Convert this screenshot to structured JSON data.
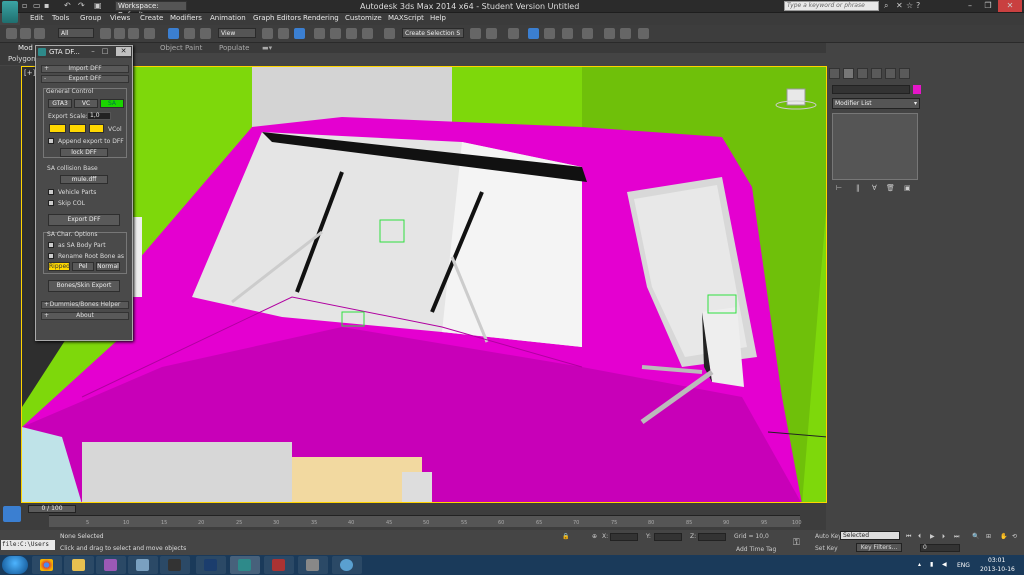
{
  "window": {
    "title": "Autodesk 3ds Max  2014 x64  - Student Version   Untitled",
    "workspace": "Workspace: Default",
    "search_placeholder": "Type a keyword or phrase"
  },
  "menu": [
    "Edit",
    "Tools",
    "Group",
    "Views",
    "Create",
    "Modifiers",
    "Animation",
    "Graph Editors",
    "Rendering",
    "Customize",
    "MAXScript",
    "Help"
  ],
  "toolbar": {
    "selection_filter": "All",
    "ref_coord": "View",
    "named_selection": "Create Selection S"
  },
  "ribbon": {
    "tabs": [
      "Mod",
      "Object Paint",
      "Populate"
    ],
    "sub": "Polygon"
  },
  "viewport": {
    "label": "[+]",
    "view_cube": "viewcube"
  },
  "gta_panel": {
    "title": "GTA DF...",
    "import": "Import DFF",
    "export": "Export DFF",
    "general_control": "General Control",
    "game_buttons": [
      "GTA3",
      "VC",
      "SA"
    ],
    "export_scale_label": "Export Scale:",
    "export_scale_value": "1,0",
    "vcol_label": "VCol",
    "append_label": "Append export to DFF",
    "lock_dff": "lock DFF",
    "sa_collision": "SA collision Base",
    "mule_dff": "mule.dff",
    "vehicle_parts": "Vehicle Parts",
    "skip_col": "Skip COL",
    "export_dff_btn": "Export DFF",
    "sa_char_options": "SA Char. Options",
    "as_sa_body_part": "as SA Body Part",
    "rename_root": "Rename Root Bone as",
    "bone_buttons": [
      "Ripped",
      "Pel",
      "Normal"
    ],
    "bones_skin_export": "Bones/Skin Export",
    "dummies_helper": "Dummies/Bones Helper",
    "about": "About"
  },
  "cmd_panel": {
    "modifier_list": "Modifier List",
    "object_color": "#e516c9"
  },
  "timeline": {
    "slider": "0 / 100",
    "ticks": [
      "5",
      "10",
      "15",
      "20",
      "25",
      "30",
      "35",
      "40",
      "45",
      "50",
      "55",
      "60",
      "65",
      "70",
      "75",
      "80",
      "85",
      "90",
      "95",
      "100"
    ]
  },
  "status": {
    "maxscript": "file:C:\\Users",
    "line1": "None Selected",
    "line2": "Click and drag to select and move objects",
    "x": "X:",
    "y": "Y:",
    "z": "Z:",
    "grid": "Grid = 10,0",
    "add_time_tag": "Add Time Tag",
    "auto_key": "Auto Key",
    "set_key": "Set Key",
    "selected": "Selected",
    "key_filters": "Key Filters...",
    "frame": "0"
  },
  "taskbar": {
    "lang": "ENG",
    "time": "03:01",
    "date": "2013-10-16"
  },
  "colors": {
    "truck": "#e400d0",
    "background_green": "#7ed80b",
    "viewport_border": "#ffd400"
  }
}
